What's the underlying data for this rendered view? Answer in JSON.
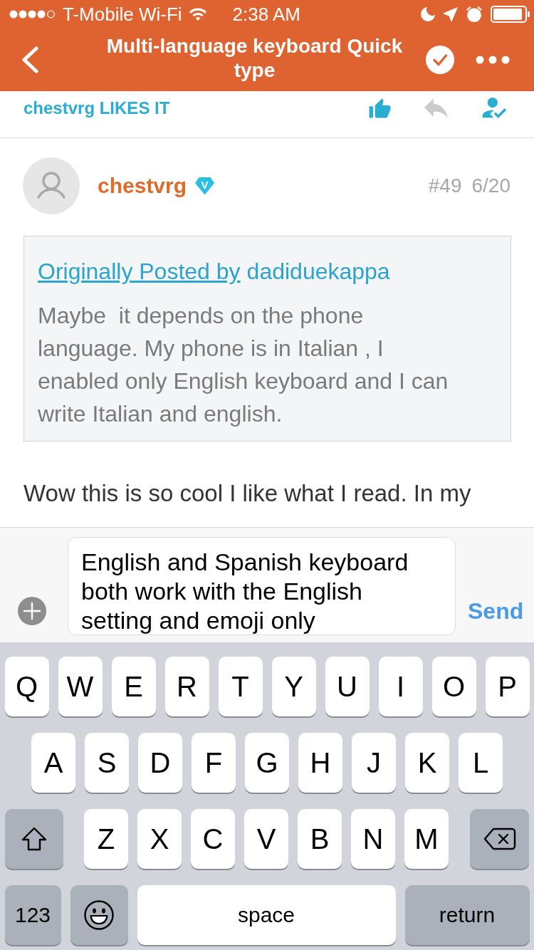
{
  "status_bar": {
    "carrier": "T-Mobile Wi-Fi",
    "time": "2:38 AM"
  },
  "nav_bar": {
    "title": "Multi-language keyboard Quick type"
  },
  "likes_bar": {
    "text": "chestvrg LIKES IT"
  },
  "post": {
    "author": "chestvrg",
    "badge": "V",
    "number": "#49",
    "page": "6/20",
    "quote": {
      "link": "Originally Posted by",
      "author": "dadiduekappa",
      "text": "Maybe  it depends on the phone language. My phone is in Italian , I enabled only English keyboard and I can write Italian and english."
    },
    "body": "Wow this is so cool I like what I read. In my"
  },
  "composer": {
    "value": "English and Spanish keyboard both work with the English setting and emoji only",
    "send": "Send"
  },
  "keyboard": {
    "rows": [
      {
        "keys": [
          {
            "kind": "letter",
            "label": "Q"
          },
          {
            "kind": "letter",
            "label": "W"
          },
          {
            "kind": "letter",
            "label": "E"
          },
          {
            "kind": "letter",
            "label": "R"
          },
          {
            "kind": "letter",
            "label": "T"
          },
          {
            "kind": "letter",
            "label": "Y"
          },
          {
            "kind": "letter",
            "label": "U"
          },
          {
            "kind": "letter",
            "label": "I"
          },
          {
            "kind": "letter",
            "label": "O"
          },
          {
            "kind": "letter",
            "label": "P"
          }
        ]
      },
      {
        "keys": [
          {
            "kind": "letter",
            "label": "A"
          },
          {
            "kind": "letter",
            "label": "S"
          },
          {
            "kind": "letter",
            "label": "D"
          },
          {
            "kind": "letter",
            "label": "F"
          },
          {
            "kind": "letter",
            "label": "G"
          },
          {
            "kind": "letter",
            "label": "H"
          },
          {
            "kind": "letter",
            "label": "J"
          },
          {
            "kind": "letter",
            "label": "K"
          },
          {
            "kind": "letter",
            "label": "L"
          }
        ]
      },
      {
        "keys": [
          {
            "kind": "shift"
          },
          {
            "kind": "letter",
            "label": "Z"
          },
          {
            "kind": "letter",
            "label": "X"
          },
          {
            "kind": "letter",
            "label": "C"
          },
          {
            "kind": "letter",
            "label": "V"
          },
          {
            "kind": "letter",
            "label": "B"
          },
          {
            "kind": "letter",
            "label": "N"
          },
          {
            "kind": "letter",
            "label": "M"
          },
          {
            "kind": "delete"
          }
        ]
      },
      {
        "keys": [
          {
            "kind": "numbers",
            "label": "123"
          },
          {
            "kind": "emoji"
          },
          {
            "kind": "space",
            "label": "space"
          },
          {
            "kind": "return",
            "label": "return"
          }
        ]
      }
    ]
  }
}
